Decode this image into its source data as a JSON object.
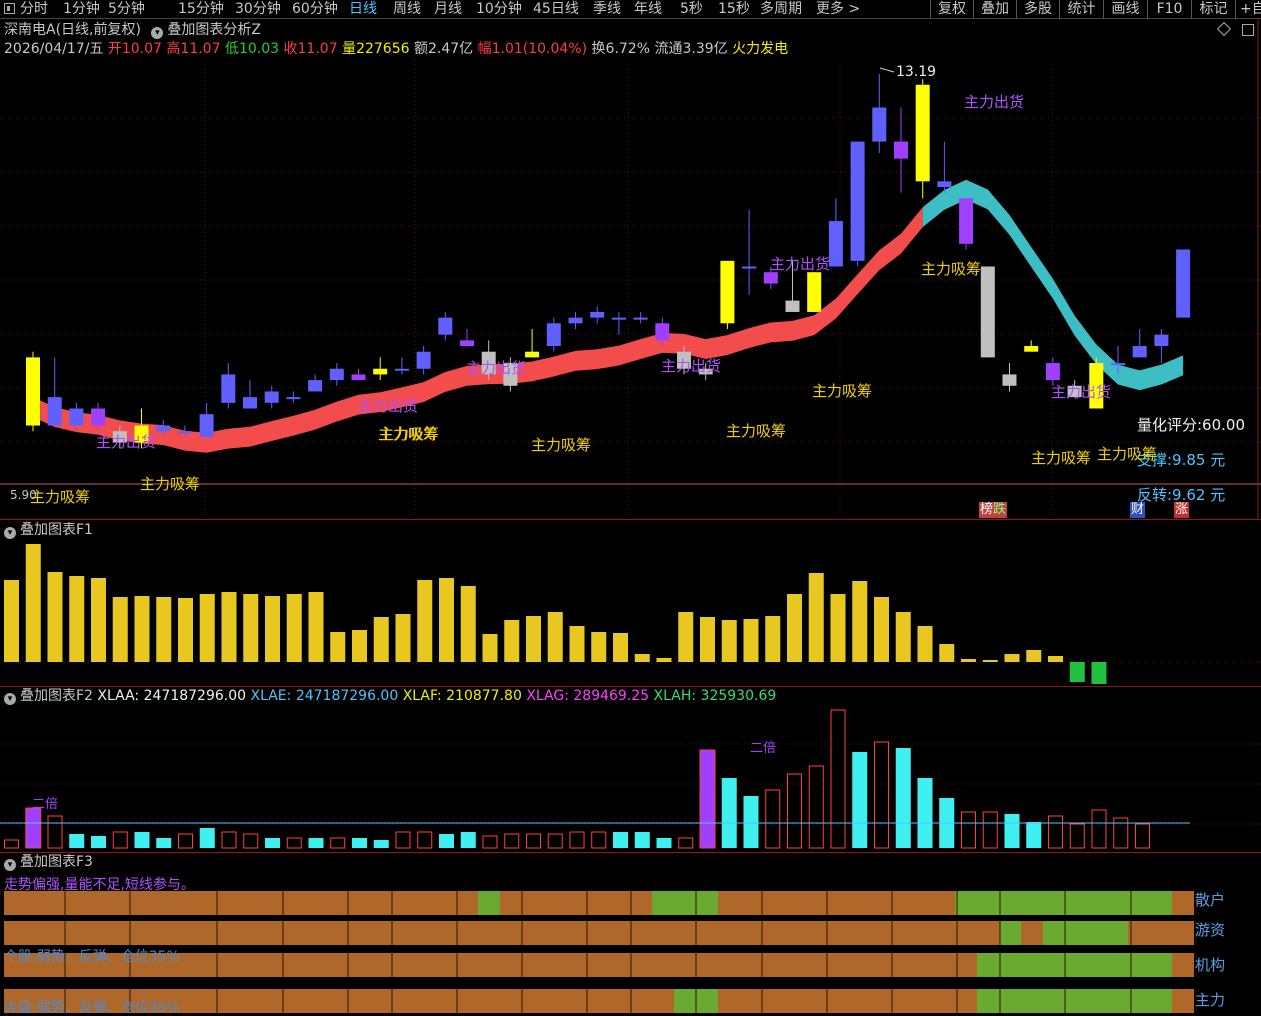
{
  "toolbar": {
    "periods": [
      "分时",
      "1分钟",
      "5分钟",
      "15分钟",
      "30分钟",
      "60分钟",
      "日线",
      "周线",
      "月线",
      "10分钟",
      "45日线",
      "季线",
      "年线",
      "5秒",
      "15秒",
      "多周期",
      "更多 >"
    ],
    "active": "日线",
    "right_buttons": [
      "复权",
      "叠加",
      "多股",
      "统计",
      "画线",
      "F10",
      "标记",
      "+自"
    ]
  },
  "header": {
    "title": "深南电A(日线,前复权)",
    "overlay": "叠加图表分析Z",
    "date": "2026/04/17/五",
    "open_label": "开",
    "open": "10.07",
    "high_label": "高",
    "high": "11.07",
    "low_label": "低",
    "low": "10.03",
    "close_label": "收",
    "close": "11.07",
    "vol_label": "量",
    "vol": "227656",
    "amt_label": "额",
    "amt": "2.47亿",
    "chg_label": "幅",
    "chg": "1.01(10.04%)",
    "turnover_label": "换",
    "turnover": "6.72%",
    "float_label": "流通",
    "float": "3.39亿",
    "concept": "火力发电"
  },
  "colors": {
    "up": "#6060ff",
    "down": "#ffff00",
    "gray": "#c0c0c0",
    "purple": "#a040ff",
    "band": "#ff5050",
    "band2": "#40c8d0",
    "vol": "#e8c820",
    "vol_green": "#20c040"
  },
  "main": {
    "high_mark": "13.19",
    "low_mark": "5.90",
    "score": "量化评分:60.00",
    "support": "支撑:9.85 元",
    "reversal": "反转:9.62 元",
    "badges": {
      "bang": "榜",
      "die": "跌",
      "cai": "财",
      "zhang": "涨"
    },
    "signals": [
      {
        "text": "主力出货",
        "type": "sell"
      },
      {
        "text": "主力吸筹",
        "type": "buy"
      },
      {
        "text": "主力吸筹",
        "type": "buy"
      },
      {
        "text": "主力出货",
        "type": "sell"
      },
      {
        "text": "主力吸筹",
        "type": "buy"
      },
      {
        "text": "主力出货",
        "type": "sell"
      },
      {
        "text": "主力吸筹",
        "type": "buy"
      },
      {
        "text": "主力出货",
        "type": "sell"
      },
      {
        "text": "主力吸筹",
        "type": "buy"
      },
      {
        "text": "主力出货",
        "type": "sell"
      },
      {
        "text": "主力吸筹",
        "type": "buy"
      },
      {
        "text": "主力出货",
        "type": "sell"
      },
      {
        "text": "主力吸筹",
        "type": "buy"
      },
      {
        "text": "主力出货",
        "type": "sell"
      },
      {
        "text": "主力吸筹",
        "type": "buy"
      },
      {
        "text": "主力吸筹",
        "type": "buy"
      }
    ]
  },
  "candles": [
    {
      "o": 8.2,
      "c": 7.0,
      "h": 8.3,
      "l": 6.9,
      "t": "down"
    },
    {
      "o": 7.0,
      "c": 7.5,
      "h": 8.2,
      "l": 7.0,
      "t": "up"
    },
    {
      "o": 7.0,
      "c": 7.3,
      "h": 7.4,
      "l": 6.9,
      "t": "up"
    },
    {
      "o": 7.0,
      "c": 7.3,
      "h": 7.4,
      "l": 6.9,
      "t": "purple"
    },
    {
      "o": 6.7,
      "c": 6.9,
      "h": 7.0,
      "l": 6.6,
      "t": "gray"
    },
    {
      "o": 6.7,
      "c": 7.0,
      "h": 7.3,
      "l": 6.6,
      "t": "down"
    },
    {
      "o": 6.9,
      "c": 7.0,
      "h": 7.1,
      "l": 6.8,
      "t": "up"
    },
    {
      "o": 6.9,
      "c": 6.9,
      "h": 7.0,
      "l": 6.8,
      "t": "up"
    },
    {
      "o": 6.8,
      "c": 7.2,
      "h": 7.4,
      "l": 6.8,
      "t": "up"
    },
    {
      "o": 7.4,
      "c": 7.9,
      "h": 8.1,
      "l": 7.3,
      "t": "up"
    },
    {
      "o": 7.3,
      "c": 7.5,
      "h": 7.8,
      "l": 7.3,
      "t": "up"
    },
    {
      "o": 7.4,
      "c": 7.6,
      "h": 7.7,
      "l": 7.3,
      "t": "up"
    },
    {
      "o": 7.5,
      "c": 7.5,
      "h": 7.6,
      "l": 7.4,
      "t": "up"
    },
    {
      "o": 7.6,
      "c": 7.8,
      "h": 7.9,
      "l": 7.6,
      "t": "up"
    },
    {
      "o": 7.8,
      "c": 8.0,
      "h": 8.1,
      "l": 7.7,
      "t": "up"
    },
    {
      "o": 7.8,
      "c": 7.9,
      "h": 8.0,
      "l": 7.8,
      "t": "purple"
    },
    {
      "o": 8.0,
      "c": 7.9,
      "h": 8.2,
      "l": 7.8,
      "t": "down"
    },
    {
      "o": 8.0,
      "c": 8.0,
      "h": 8.2,
      "l": 7.9,
      "t": "up"
    },
    {
      "o": 8.0,
      "c": 8.3,
      "h": 8.4,
      "l": 7.9,
      "t": "up"
    },
    {
      "o": 8.6,
      "c": 8.9,
      "h": 9.0,
      "l": 8.5,
      "t": "up"
    },
    {
      "o": 8.4,
      "c": 8.5,
      "h": 8.7,
      "l": 8.4,
      "t": "purple"
    },
    {
      "o": 8.3,
      "c": 7.9,
      "h": 8.5,
      "l": 7.8,
      "t": "gray"
    },
    {
      "o": 8.1,
      "c": 7.7,
      "h": 8.2,
      "l": 7.6,
      "t": "gray"
    },
    {
      "o": 8.2,
      "c": 8.3,
      "h": 8.7,
      "l": 8.2,
      "t": "down"
    },
    {
      "o": 8.4,
      "c": 8.8,
      "h": 8.9,
      "l": 8.3,
      "t": "up"
    },
    {
      "o": 8.8,
      "c": 8.9,
      "h": 9.0,
      "l": 8.7,
      "t": "up"
    },
    {
      "o": 8.9,
      "c": 9.0,
      "h": 9.1,
      "l": 8.8,
      "t": "up"
    },
    {
      "o": 8.9,
      "c": 8.9,
      "h": 9.0,
      "l": 8.6,
      "t": "up"
    },
    {
      "o": 8.9,
      "c": 8.9,
      "h": 9.0,
      "l": 8.8,
      "t": "up"
    },
    {
      "o": 8.8,
      "c": 8.5,
      "h": 8.9,
      "l": 8.4,
      "t": "purple"
    },
    {
      "o": 8.3,
      "c": 8.0,
      "h": 8.4,
      "l": 7.9,
      "t": "gray"
    },
    {
      "o": 8.0,
      "c": 7.9,
      "h": 8.1,
      "l": 7.8,
      "t": "gray"
    },
    {
      "o": 8.8,
      "c": 9.9,
      "h": 9.9,
      "l": 8.7,
      "t": "down"
    },
    {
      "o": 9.8,
      "c": 9.8,
      "h": 10.8,
      "l": 9.3,
      "t": "up"
    },
    {
      "o": 9.7,
      "c": 9.5,
      "h": 9.8,
      "l": 9.4,
      "t": "purple"
    },
    {
      "o": 9.0,
      "c": 9.2,
      "h": 9.9,
      "l": 9.0,
      "t": "gray"
    },
    {
      "o": 9.0,
      "c": 9.7,
      "h": 9.7,
      "l": 9.0,
      "t": "down"
    },
    {
      "o": 9.8,
      "c": 10.6,
      "h": 11.0,
      "l": 9.8,
      "t": "up"
    },
    {
      "o": 9.9,
      "c": 12.0,
      "h": 12.0,
      "l": 9.8,
      "t": "up"
    },
    {
      "o": 12.0,
      "c": 12.6,
      "h": 13.19,
      "l": 11.8,
      "t": "up"
    },
    {
      "o": 11.7,
      "c": 12.0,
      "h": 12.6,
      "l": 11.1,
      "t": "purple"
    },
    {
      "o": 13.0,
      "c": 11.3,
      "h": 13.1,
      "l": 11.0,
      "t": "down"
    },
    {
      "o": 11.2,
      "c": 11.3,
      "h": 12.0,
      "l": 11.1,
      "t": "up"
    },
    {
      "o": 11.0,
      "c": 10.2,
      "h": 11.0,
      "l": 10.1,
      "t": "purple"
    },
    {
      "o": 9.8,
      "c": 8.2,
      "h": 9.8,
      "l": 8.2,
      "t": "gray"
    },
    {
      "o": 7.9,
      "c": 7.7,
      "h": 8.1,
      "l": 7.6,
      "t": "gray"
    },
    {
      "o": 8.3,
      "c": 8.4,
      "h": 8.5,
      "l": 8.3,
      "t": "down"
    },
    {
      "o": 8.1,
      "c": 7.8,
      "h": 8.2,
      "l": 7.7,
      "t": "purple"
    },
    {
      "o": 7.7,
      "c": 7.5,
      "h": 7.8,
      "l": 7.5,
      "t": "gray"
    },
    {
      "o": 8.1,
      "c": 7.3,
      "h": 8.2,
      "l": 7.3,
      "t": "down"
    },
    {
      "o": 8.1,
      "c": 8.1,
      "h": 8.4,
      "l": 7.9,
      "t": "up"
    },
    {
      "o": 8.2,
      "c": 8.4,
      "h": 8.7,
      "l": 8.2,
      "t": "up"
    },
    {
      "o": 8.4,
      "c": 8.6,
      "h": 8.7,
      "l": 8.1,
      "t": "up"
    },
    {
      "o": 8.9,
      "c": 10.1,
      "h": 10.1,
      "l": 8.9,
      "t": "up"
    }
  ],
  "f1": {
    "title": "叠加图表F1",
    "values": [
      82,
      118,
      90,
      86,
      84,
      65,
      66,
      65,
      64,
      68,
      70,
      68,
      66,
      68,
      70,
      30,
      32,
      45,
      48,
      82,
      84,
      76,
      28,
      42,
      46,
      50,
      36,
      30,
      29,
      8,
      4,
      50,
      45,
      42,
      43,
      46,
      68,
      89,
      68,
      81,
      65,
      50,
      36,
      18,
      3,
      2,
      8,
      12,
      6,
      -20,
      -22
    ]
  },
  "f2": {
    "title": "叠加图表F2",
    "xlaa_label": "XLAA:",
    "xlaa": "247187296.00",
    "xlae_label": "XLAE:",
    "xlae": "247187296.00",
    "xlaf_label": "XLAF:",
    "xlaf": "210877.80",
    "xlag_label": "XLAG:",
    "xlag": "289469.25",
    "xlah_label": "XLAH:",
    "xlah": "325930.69",
    "double_label": "二倍",
    "bars": [
      {
        "v": 8,
        "t": "r"
      },
      {
        "v": 40,
        "t": "p"
      },
      {
        "v": 32,
        "t": "r"
      },
      {
        "v": 14,
        "t": "c"
      },
      {
        "v": 12,
        "t": "c"
      },
      {
        "v": 16,
        "t": "r"
      },
      {
        "v": 16,
        "t": "c"
      },
      {
        "v": 10,
        "t": "c"
      },
      {
        "v": 14,
        "t": "r"
      },
      {
        "v": 20,
        "t": "c"
      },
      {
        "v": 16,
        "t": "r"
      },
      {
        "v": 14,
        "t": "r"
      },
      {
        "v": 10,
        "t": "c"
      },
      {
        "v": 10,
        "t": "r"
      },
      {
        "v": 10,
        "t": "c"
      },
      {
        "v": 10,
        "t": "r"
      },
      {
        "v": 10,
        "t": "c"
      },
      {
        "v": 8,
        "t": "c"
      },
      {
        "v": 16,
        "t": "r"
      },
      {
        "v": 16,
        "t": "r"
      },
      {
        "v": 14,
        "t": "c"
      },
      {
        "v": 16,
        "t": "c"
      },
      {
        "v": 12,
        "t": "r"
      },
      {
        "v": 14,
        "t": "r"
      },
      {
        "v": 14,
        "t": "r"
      },
      {
        "v": 14,
        "t": "r"
      },
      {
        "v": 16,
        "t": "r"
      },
      {
        "v": 16,
        "t": "r"
      },
      {
        "v": 16,
        "t": "c"
      },
      {
        "v": 16,
        "t": "c"
      },
      {
        "v": 10,
        "t": "c"
      },
      {
        "v": 10,
        "t": "r"
      },
      {
        "v": 98,
        "t": "p"
      },
      {
        "v": 70,
        "t": "c"
      },
      {
        "v": 52,
        "t": "c"
      },
      {
        "v": 58,
        "t": "r"
      },
      {
        "v": 74,
        "t": "r"
      },
      {
        "v": 82,
        "t": "r"
      },
      {
        "v": 138,
        "t": "r"
      },
      {
        "v": 96,
        "t": "c"
      },
      {
        "v": 106,
        "t": "r"
      },
      {
        "v": 100,
        "t": "c"
      },
      {
        "v": 70,
        "t": "c"
      },
      {
        "v": 50,
        "t": "c"
      },
      {
        "v": 36,
        "t": "r"
      },
      {
        "v": 36,
        "t": "r"
      },
      {
        "v": 34,
        "t": "c"
      },
      {
        "v": 26,
        "t": "c"
      },
      {
        "v": 32,
        "t": "r"
      },
      {
        "v": 24,
        "t": "r"
      },
      {
        "v": 38,
        "t": "r"
      },
      {
        "v": 30,
        "t": "r"
      },
      {
        "v": 24,
        "t": "r"
      }
    ]
  },
  "f3": {
    "title": "叠加图表F3",
    "tip": "走势偏强,量能不足,短线参与。",
    "stock_advice": "个股:弱势、反弹、仓位35%",
    "market_advice": "大盘:弱势、反弹、仓位35%",
    "rows": [
      {
        "label": "散户",
        "green": [
          [
            478,
            500
          ],
          [
            652,
            718
          ],
          [
            955,
            1172
          ]
        ]
      },
      {
        "label": "游资",
        "green": [
          [
            1000,
            1021
          ],
          [
            1043,
            1128
          ]
        ]
      },
      {
        "label": "机构",
        "green": [
          [
            977,
            1172
          ]
        ]
      },
      {
        "label": "主力",
        "green": [
          [
            674,
            718
          ],
          [
            977,
            1172
          ]
        ]
      }
    ]
  }
}
